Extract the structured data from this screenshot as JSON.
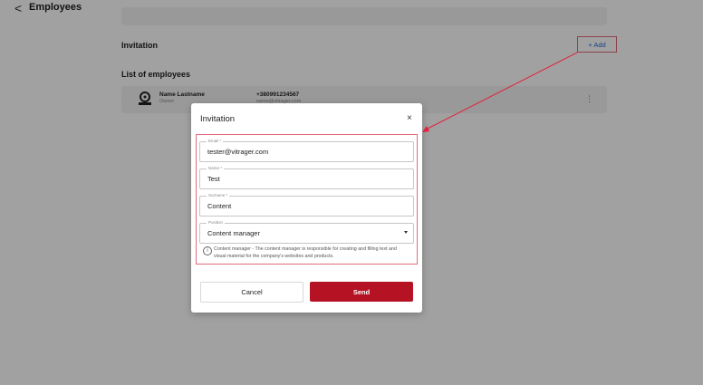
{
  "header": {
    "back_glyph": "<",
    "title": "Employees"
  },
  "invitation_section": {
    "title": "Invitation",
    "add_label": "+ Add"
  },
  "employees_section": {
    "title": "List of employees",
    "employee": {
      "name": "Name Lastname",
      "role": "Owner",
      "phone": "+380991234567",
      "email": "name@vitrager.com"
    },
    "more_glyph": "⋮"
  },
  "dialog": {
    "title": "Invitation",
    "close_glyph": "×",
    "fields": {
      "email": {
        "label": "Email *",
        "value": "tester@vitrager.com"
      },
      "name": {
        "label": "Name *",
        "value": "Test"
      },
      "surname": {
        "label": "Surname *",
        "value": "Content"
      },
      "position": {
        "label": "Position",
        "value": "Content manager"
      }
    },
    "info_glyph": "i",
    "position_info": "Content manager - The content manager is responsible for creating and filling text and visual material for the company's websites and products.",
    "cancel_label": "Cancel",
    "send_label": "Send"
  },
  "colors": {
    "accent_red": "#b51224",
    "highlight_border": "#e36a7a",
    "add_text": "#2d6bd6"
  }
}
